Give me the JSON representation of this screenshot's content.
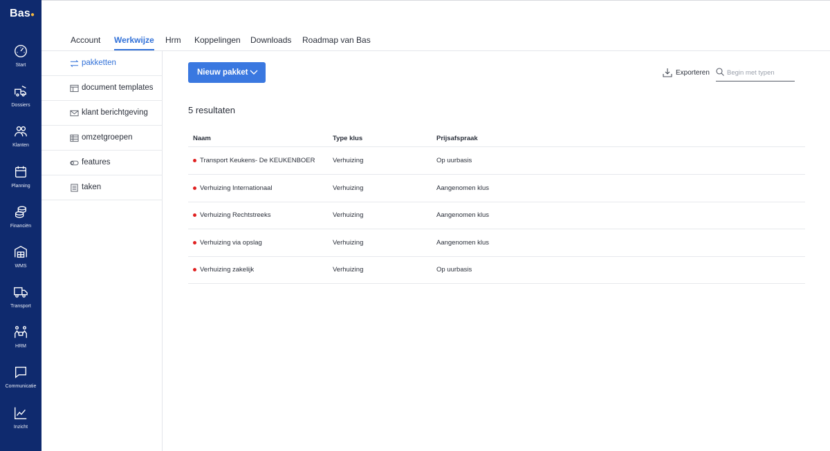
{
  "app": {
    "brand": "Bas",
    "accent": "#3a78e0",
    "rail_color": "#0f2a6e"
  },
  "rail": {
    "items": [
      {
        "label": "Start",
        "icon": "gauge-icon"
      },
      {
        "label": "Dossiers",
        "icon": "truck-icon"
      },
      {
        "label": "Klanten",
        "icon": "users-icon"
      },
      {
        "label": "Planning",
        "icon": "calendar-icon"
      },
      {
        "label": "Financiën",
        "icon": "coins-icon"
      },
      {
        "label": "WMS",
        "icon": "warehouse-icon"
      },
      {
        "label": "Transport",
        "icon": "delivery-truck-icon"
      },
      {
        "label": "HRM",
        "icon": "team-icon"
      },
      {
        "label": "Communicatie",
        "icon": "chat-icon"
      },
      {
        "label": "Inzicht",
        "icon": "chart-line-icon"
      }
    ]
  },
  "tabs": [
    {
      "label": "Account",
      "active": false
    },
    {
      "label": "Werkwijze",
      "active": true
    },
    {
      "label": "Hrm",
      "active": false
    },
    {
      "label": "Koppelingen",
      "active": false
    },
    {
      "label": "Downloads",
      "active": false
    },
    {
      "label": "Roadmap van Bas",
      "active": false
    }
  ],
  "subnav": {
    "items": [
      {
        "label": "pakketten",
        "icon": "switch-arrows-icon",
        "active": true
      },
      {
        "label": "document templates",
        "icon": "template-icon",
        "active": false
      },
      {
        "label": "klant berichtgeving",
        "icon": "envelope-icon",
        "active": false
      },
      {
        "label": "omzetgroepen",
        "icon": "table-icon",
        "active": false
      },
      {
        "label": "features",
        "icon": "toggle-icon",
        "active": false
      },
      {
        "label": "taken",
        "icon": "list-icon",
        "active": false
      }
    ]
  },
  "toolbar": {
    "new_button_label": "Nieuw pakket",
    "export_label": "Exporteren",
    "search_placeholder": "Begin met typen",
    "search_value": ""
  },
  "results_label": "5 resultaten",
  "table": {
    "columns": [
      "Naam",
      "Type klus",
      "Prijsafspraak"
    ],
    "status_color": "#e02020",
    "rows": [
      {
        "naam": "Transport Keukens- De KEUKENBOER",
        "type": "Verhuizing",
        "prijs": "Op uurbasis"
      },
      {
        "naam": "Verhuizing Internationaal",
        "type": "Verhuizing",
        "prijs": "Aangenomen klus"
      },
      {
        "naam": "Verhuizing Rechtstreeks",
        "type": "Verhuizing",
        "prijs": "Aangenomen klus"
      },
      {
        "naam": "Verhuizing via opslag",
        "type": "Verhuizing",
        "prijs": "Aangenomen klus"
      },
      {
        "naam": "Verhuizing zakelijk",
        "type": "Verhuizing",
        "prijs": "Op uurbasis"
      }
    ]
  }
}
